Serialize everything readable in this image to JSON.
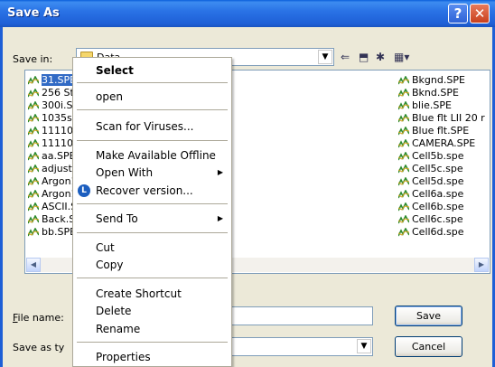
{
  "window": {
    "title": "Save As"
  },
  "toolbar": {
    "save_in_label": "Save in:",
    "save_in_value": "Data"
  },
  "files": {
    "left": [
      {
        "name": "31.SPE",
        "selected": true
      },
      {
        "name": "256 St"
      },
      {
        "name": "300i.SF"
      },
      {
        "name": "1035st"
      },
      {
        "name": "11110‹"
      },
      {
        "name": "11110‹"
      },
      {
        "name": "aa.SPE"
      },
      {
        "name": "adjust.!"
      },
      {
        "name": "Argon1"
      },
      {
        "name": "Argon1"
      },
      {
        "name": "ASCII.S"
      },
      {
        "name": "Back.SF"
      },
      {
        "name": "bb.SPE"
      }
    ],
    "right": [
      {
        "name": "Bkgnd.SPE"
      },
      {
        "name": "Bknd.SPE"
      },
      {
        "name": "blie.SPE"
      },
      {
        "name": "Blue flt LII 20 r"
      },
      {
        "name": "Blue flt.SPE"
      },
      {
        "name": "CAMERA.SPE"
      },
      {
        "name": "Cell5b.spe"
      },
      {
        "name": "Cell5c.spe"
      },
      {
        "name": "Cell5d.spe"
      },
      {
        "name": "Cell6a.spe"
      },
      {
        "name": "Cell6b.spe"
      },
      {
        "name": "Cell6c.spe"
      },
      {
        "name": "Cell6d.spe"
      }
    ]
  },
  "form": {
    "file_name_label": "File name:",
    "save_as_type_label": "Save as ty",
    "save_button": "Save",
    "cancel_button": "Cancel"
  },
  "context_menu": {
    "select": "Select",
    "open": "open",
    "scan": "Scan for Viruses...",
    "offline": "Make Available Offline",
    "open_with": "Open With",
    "recover": "Recover version...",
    "send_to": "Send To",
    "cut": "Cut",
    "copy": "Copy",
    "create_shortcut": "Create Shortcut",
    "delete": "Delete",
    "rename": "Rename",
    "properties": "Properties"
  },
  "colors": {
    "titlebar": "#1E5FD6",
    "selection": "#316AC5",
    "dialog_bg": "#ECE9D8"
  },
  "icons": {
    "file_icon": "spe-file-icon",
    "recover_icon": "recover-icon"
  }
}
